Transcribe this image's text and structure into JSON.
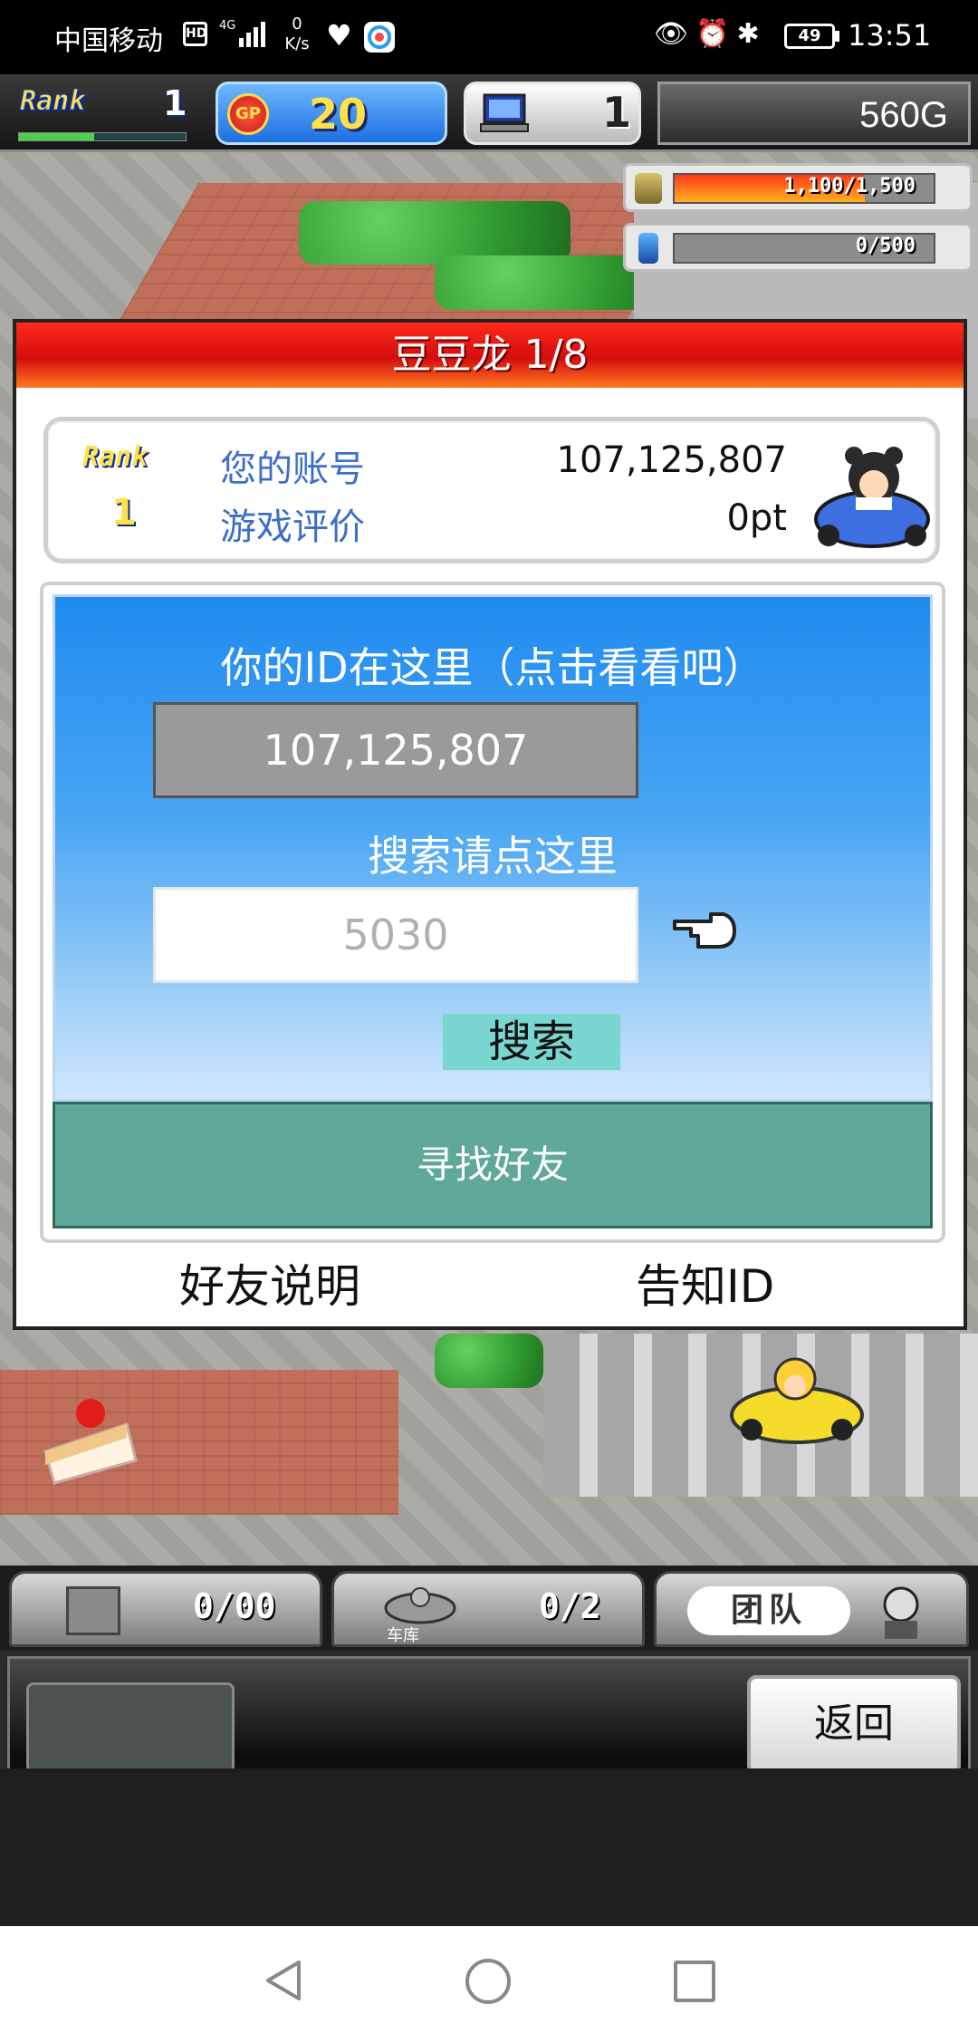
{
  "status_bar": {
    "carrier": "中国移动",
    "hd": "HD",
    "network": "4G",
    "speed_value": "0",
    "speed_unit": "K/s",
    "battery": "49",
    "time": "13:51"
  },
  "hud": {
    "rank_label": "Rank",
    "rank_value": "1",
    "rank_progress": 0.45,
    "gp_badge": "GP",
    "gp_value": "20",
    "pc_value": "1",
    "money": "560G",
    "gauge1": {
      "text": "1,100/1,500",
      "fill": 0.733,
      "color": "#ff3a1a"
    },
    "gauge2": {
      "text": "0/500",
      "fill": 0,
      "color": "#3aa0ff"
    }
  },
  "dialog": {
    "title": "豆豆龙 1/8",
    "info": {
      "rank_label": "Rank",
      "rank_value": "1",
      "account_label": "您的账号",
      "account_value": "107,125,807",
      "rating_label": "游戏评价",
      "rating_value": "0pt"
    },
    "id_heading": "你的ID在这里（点击看看吧）",
    "id_value": "107,125,807",
    "search_heading": "搜索请点这里",
    "search_placeholder": "5030",
    "search_button": "搜索",
    "find_friend_button": "寻找好友",
    "friend_help_link": "好友说明",
    "share_id_link": "告知ID"
  },
  "bottom_hud": {
    "segment1_value": "0/00",
    "segment2_label": "车库",
    "segment2_value": "0/2",
    "team_label": "团队",
    "back_button": "返回"
  },
  "icons": {
    "rank": "rank-logo-icon",
    "gp": "gp-coin-icon",
    "pc": "computer-icon",
    "money_bag": "money-bag-icon",
    "fuel": "fuel-bottle-icon",
    "pointer": "pointing-hand-icon",
    "car": "race-car-icon"
  }
}
